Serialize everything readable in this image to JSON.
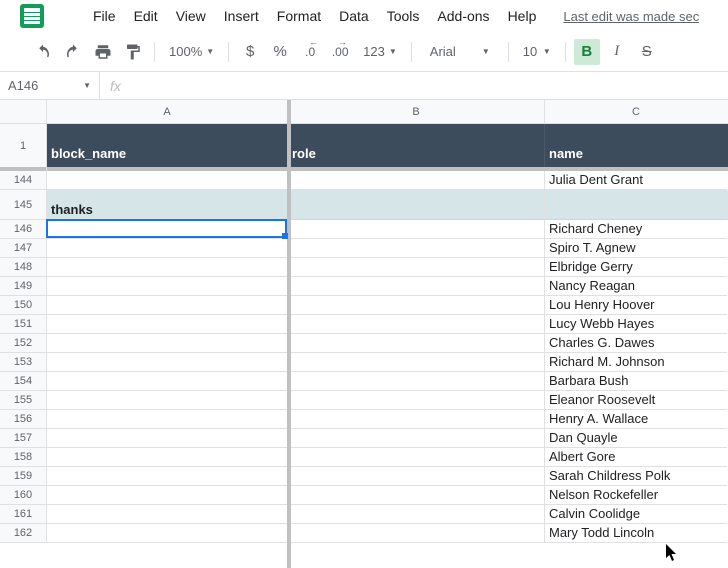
{
  "menubar": {
    "items": [
      "File",
      "Edit",
      "View",
      "Insert",
      "Format",
      "Data",
      "Tools",
      "Add-ons",
      "Help"
    ],
    "last_edit": "Last edit was made sec"
  },
  "toolbar": {
    "zoom": "100%",
    "currency": "$",
    "percent": "%",
    "dec_less": ".0",
    "dec_more": ".00",
    "num_format": "123",
    "font": "Arial",
    "font_size": "10",
    "bold": "B",
    "italic": "I",
    "strike": "S"
  },
  "formula": {
    "name_box": "A146",
    "fx": "fx"
  },
  "columns": [
    "A",
    "B",
    "C"
  ],
  "header_row": {
    "a": "block_name",
    "b": "role",
    "c": "name"
  },
  "rows": [
    {
      "num": "144",
      "a": "",
      "b": "",
      "c": "Julia Dent Grant"
    },
    {
      "num": "145",
      "a": "thanks",
      "b": "",
      "c": "",
      "tall": true
    },
    {
      "num": "146",
      "a": "",
      "b": "",
      "c": "Richard Cheney",
      "selected": true
    },
    {
      "num": "147",
      "a": "",
      "b": "",
      "c": "Spiro T. Agnew"
    },
    {
      "num": "148",
      "a": "",
      "b": "",
      "c": "Elbridge Gerry"
    },
    {
      "num": "149",
      "a": "",
      "b": "",
      "c": "Nancy Reagan"
    },
    {
      "num": "150",
      "a": "",
      "b": "",
      "c": "Lou Henry Hoover"
    },
    {
      "num": "151",
      "a": "",
      "b": "",
      "c": "Lucy Webb Hayes"
    },
    {
      "num": "152",
      "a": "",
      "b": "",
      "c": "Charles G. Dawes"
    },
    {
      "num": "153",
      "a": "",
      "b": "",
      "c": "Richard M. Johnson"
    },
    {
      "num": "154",
      "a": "",
      "b": "",
      "c": "Barbara Bush"
    },
    {
      "num": "155",
      "a": "",
      "b": "",
      "c": "Eleanor Roosevelt"
    },
    {
      "num": "156",
      "a": "",
      "b": "",
      "c": "Henry A. Wallace"
    },
    {
      "num": "157",
      "a": "",
      "b": "",
      "c": "Dan Quayle"
    },
    {
      "num": "158",
      "a": "",
      "b": "",
      "c": "Albert Gore"
    },
    {
      "num": "159",
      "a": "",
      "b": "",
      "c": "Sarah Childress Polk"
    },
    {
      "num": "160",
      "a": "",
      "b": "",
      "c": "Nelson Rockefeller"
    },
    {
      "num": "161",
      "a": "",
      "b": "",
      "c": "Calvin Coolidge"
    },
    {
      "num": "162",
      "a": "",
      "b": "",
      "c": "Mary Todd Lincoln"
    }
  ]
}
